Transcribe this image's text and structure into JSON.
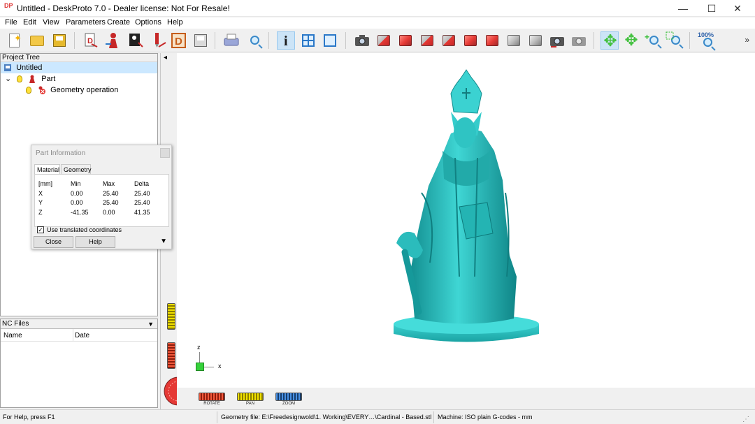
{
  "window": {
    "title": "Untitled - DeskProto 7.0 - Dealer license: Not For Resale!",
    "app_icon_text": "DP",
    "minimize": "—",
    "maximize": "☐",
    "close": "✕"
  },
  "menu": [
    "File",
    "Edit",
    "View",
    "Parameters",
    "Create",
    "Options",
    "Help"
  ],
  "toolbar": {
    "zoom_100_label": "100%",
    "overflow_glyph": "»",
    "active_tool": "part-information"
  },
  "project_tree": {
    "header": "Project Tree",
    "items": [
      {
        "label": "Untitled",
        "selected": true
      },
      {
        "label": "Part",
        "expander": "⌄"
      },
      {
        "label": "Geometry operation"
      }
    ]
  },
  "nc_files": {
    "header": "NC Files",
    "columns": [
      "Name",
      "Date"
    ]
  },
  "viewport": {
    "collapse_glyph": "◂",
    "axis_z": "z",
    "axis_x": "x",
    "model_color": "#2ec4c4",
    "wheels": {
      "rotate_label": "ROTATE",
      "pan_label": "PAN",
      "zoom_label": "ZOOM"
    }
  },
  "part_info_dialog": {
    "title": "Part Information",
    "tabs": [
      "Material",
      "Geometry"
    ],
    "active_tab": "Material",
    "columns": [
      "[mm]",
      "Min",
      "Max",
      "Delta"
    ],
    "rows": [
      {
        "axis": "X",
        "min": "0.00",
        "max": "25.40",
        "delta": "25.40"
      },
      {
        "axis": "Y",
        "min": "0.00",
        "max": "25.40",
        "delta": "25.40"
      },
      {
        "axis": "Z",
        "min": "-41.35",
        "max": "0.00",
        "delta": "41.35"
      }
    ],
    "checkbox_label": "Use translated coordinates",
    "checkbox_checked": "✓",
    "close_label": "Close",
    "help_label": "Help",
    "more_glyph": "▼"
  },
  "statusbar": {
    "help": "For Help, press F1",
    "geometry": "Geometry file: E:\\Freedesignwold\\1. Working\\EVERY…\\Cardinal - Based.stl",
    "machine": "Machine: ISO plain G-codes - mm"
  }
}
